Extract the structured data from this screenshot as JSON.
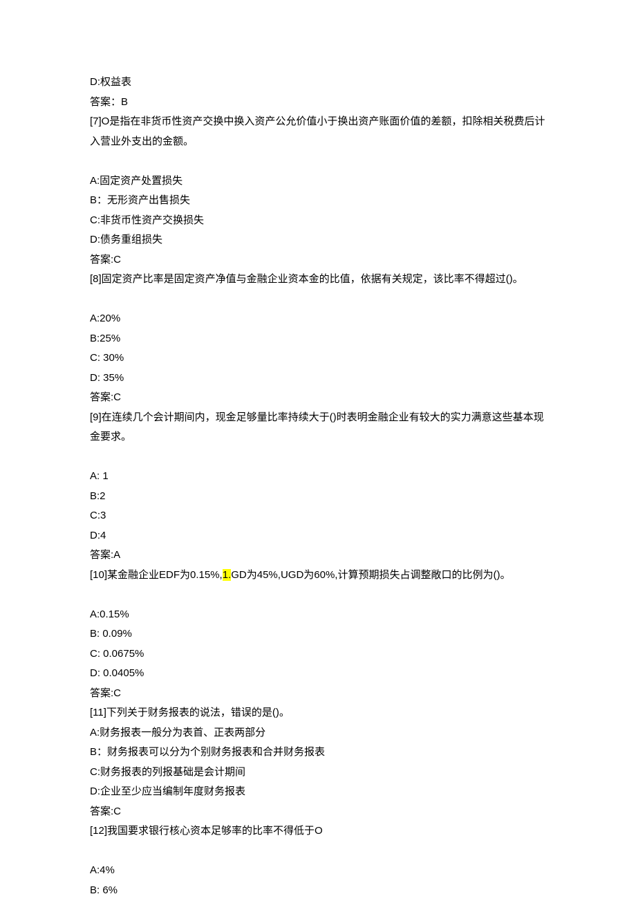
{
  "lines": [
    {
      "text": "D:权益表"
    },
    {
      "text": "答案：B"
    },
    {
      "text": "[7]O是指在非货币性资产交换中换入资产公允价值小于换出资产账面价值的差额，扣除相关税费后计入营业外支出的金额。"
    },
    {
      "text": ""
    },
    {
      "text": "A:固定资产处置损失"
    },
    {
      "text": "B：无形资产出售损失"
    },
    {
      "text": "C:非货币性资产交换损失"
    },
    {
      "text": "D:债务重组损失"
    },
    {
      "text": "答案:C"
    },
    {
      "text": "[8]固定资产比率是固定资产净值与金融企业资本金的比值，依据有关规定，该比率不得超过()。"
    },
    {
      "text": ""
    },
    {
      "text": "A:20%"
    },
    {
      "text": "B:25%"
    },
    {
      "text": "C:    30%"
    },
    {
      "text": "D:    35%"
    },
    {
      "text": "答案:C"
    },
    {
      "text": "[9]在连续几个会计期间内，现金足够量比率持续大于()时表明金融企业有较大的实力满意这些基本现金要求。"
    },
    {
      "text": ""
    },
    {
      "text": "A:    1"
    },
    {
      "text": "B:2"
    },
    {
      "text": "C:3"
    },
    {
      "text": "D:4"
    },
    {
      "text": "答案:A"
    },
    {
      "segments": [
        {
          "text": "[10]某金融企业EDF为0.15%,"
        },
        {
          "text": "1.",
          "highlight": true
        },
        {
          "text": "GD为45%,UGD为60%,计算预期损失占调整敞口的比例为()。"
        }
      ]
    },
    {
      "text": ""
    },
    {
      "text": "A:0.15%"
    },
    {
      "text": "B:    0.09%"
    },
    {
      "text": "C:    0.0675%"
    },
    {
      "text": "D:    0.0405%"
    },
    {
      "text": "答案:C"
    },
    {
      "text": "[11]下列关于财务报表的说法，错误的是()。"
    },
    {
      "text": "A:财务报表一般分为表首、正表两部分"
    },
    {
      "text": "B：财务报表可以分为个别财务报表和合并财务报表"
    },
    {
      "text": "C:财务报表的列报基础是会计期间"
    },
    {
      "text": "D:企业至少应当编制年度财务报表"
    },
    {
      "text": "答案:C"
    },
    {
      "text": "[12]我国要求银行核心资本足够率的比率不得低于O"
    },
    {
      "text": ""
    },
    {
      "text": "A:4%"
    },
    {
      "text": "B:    6%"
    }
  ]
}
